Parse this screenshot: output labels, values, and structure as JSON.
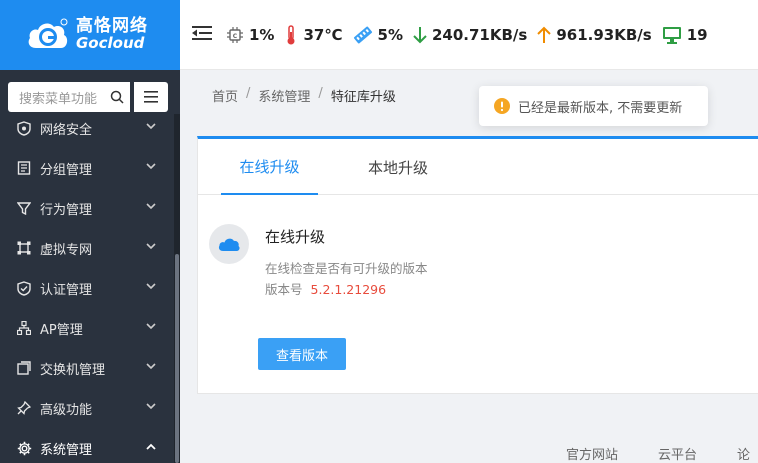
{
  "logo": {
    "cn": "高恪网络",
    "en": "Gocloud"
  },
  "header": {
    "cpu": "1%",
    "temperature": "37℃",
    "memory": "5%",
    "download": "240.71KB/s",
    "upload": "961.93KB/s",
    "devices": "19"
  },
  "sidebar": {
    "search_placeholder": "搜索菜单功能",
    "items": [
      {
        "label": "网络安全",
        "icon": "shield-icon"
      },
      {
        "label": "分组管理",
        "icon": "group-icon"
      },
      {
        "label": "行为管理",
        "icon": "filter-icon"
      },
      {
        "label": "虚拟专网",
        "icon": "vpn-icon"
      },
      {
        "label": "认证管理",
        "icon": "check-shield-icon"
      },
      {
        "label": "AP管理",
        "icon": "network-icon"
      },
      {
        "label": "交换机管理",
        "icon": "switch-icon"
      },
      {
        "label": "高级功能",
        "icon": "pin-icon"
      },
      {
        "label": "系统管理",
        "icon": "gear-icon"
      }
    ]
  },
  "breadcrumb": [
    "首页",
    "系统管理",
    "特征库升级"
  ],
  "toast": {
    "text": "已经是最新版本, 不需要更新"
  },
  "tabs": [
    "在线升级",
    "本地升级"
  ],
  "update": {
    "title": "在线升级",
    "description": "在线检查是否有可升级的版本",
    "version_label": "版本号",
    "version": "5.2.1.21296",
    "button": "查看版本"
  },
  "footer": [
    "官方网站",
    "云平台",
    "论"
  ],
  "colors": {
    "primary": "#1e8cf0",
    "sidebar": "#2a323e",
    "version": "#e84c3d",
    "warning": "#f5a623"
  }
}
